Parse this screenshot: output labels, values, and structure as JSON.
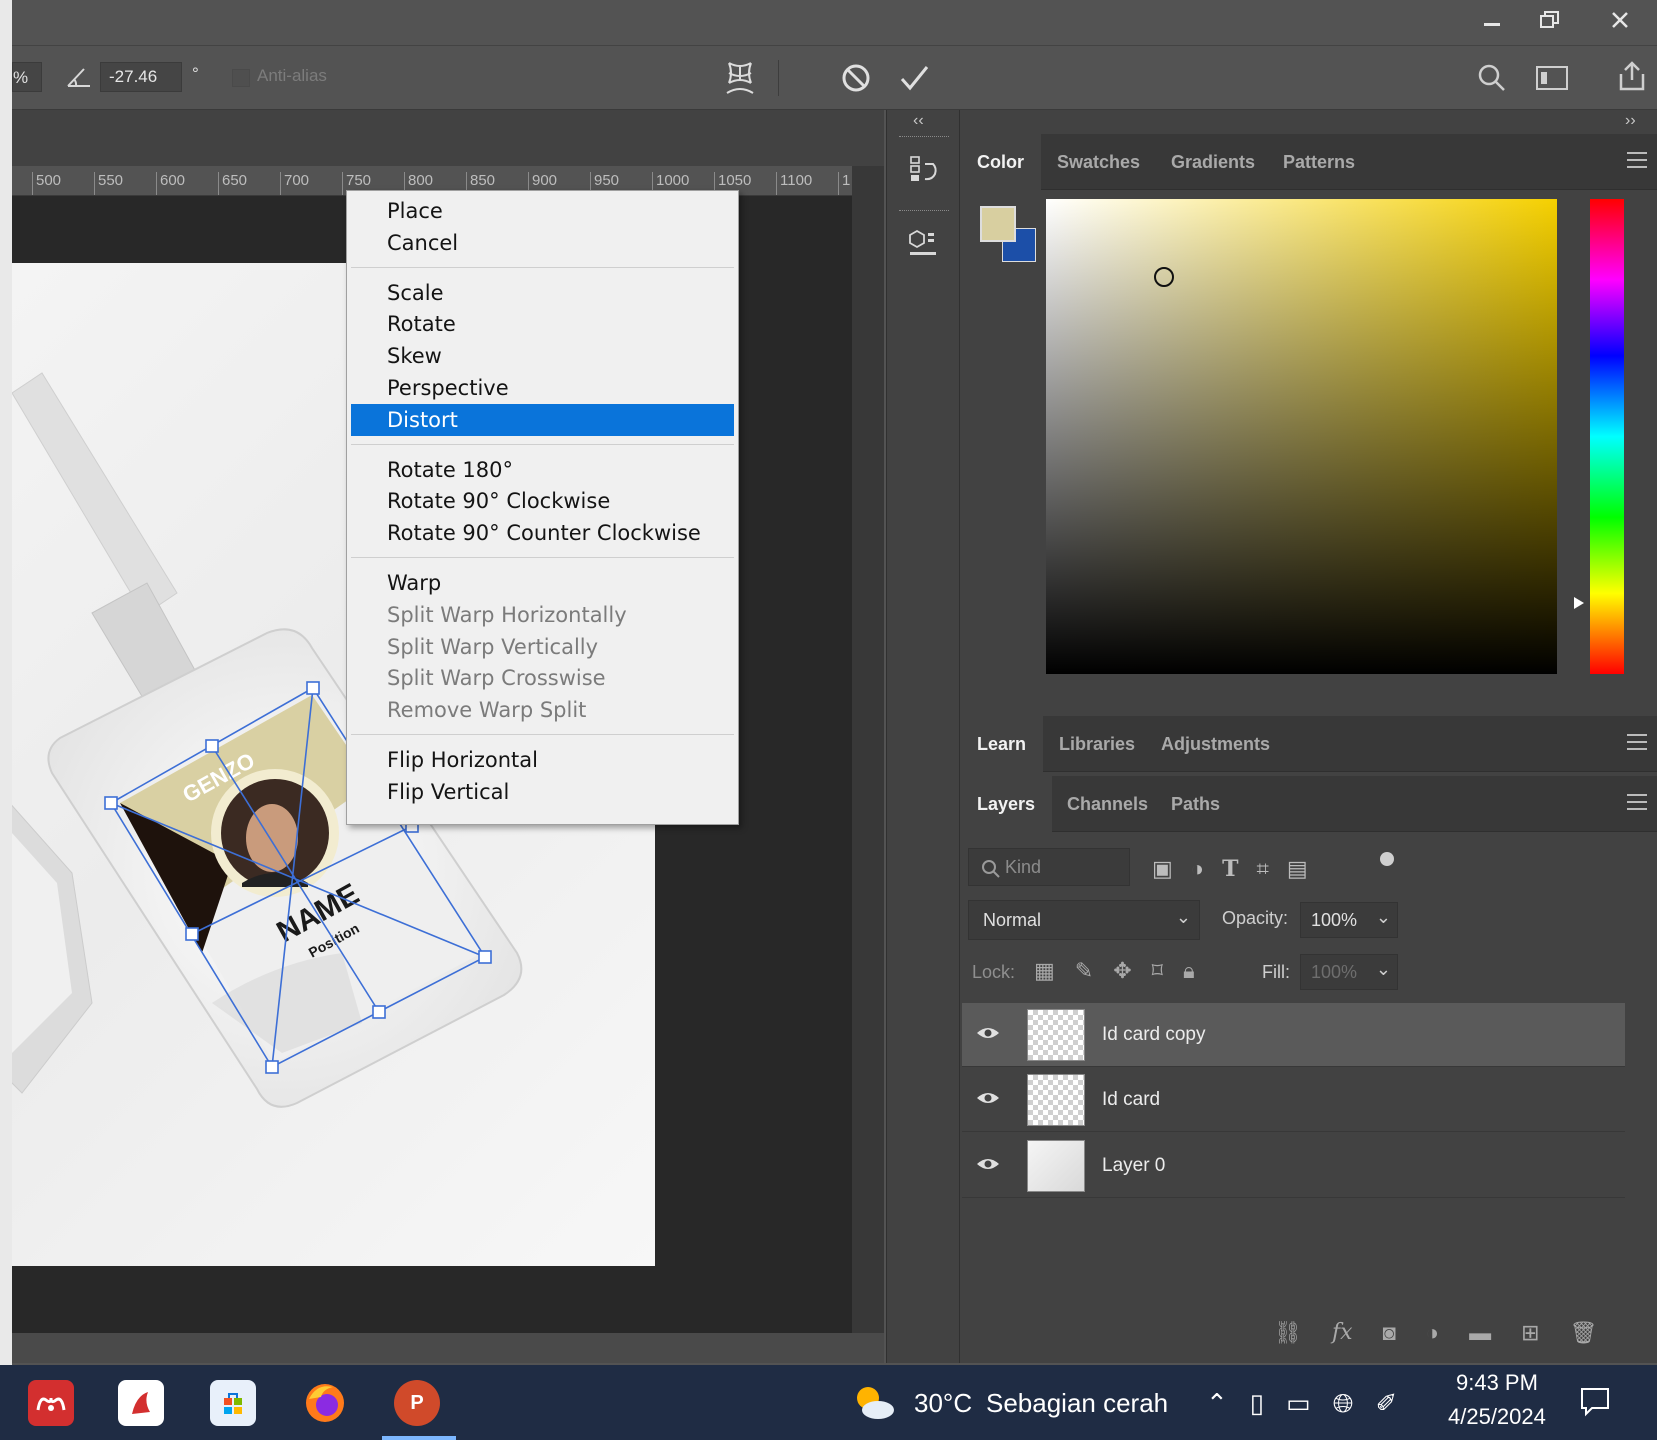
{
  "window": {
    "controls": {
      "minimize": "minimize-icon",
      "restore": "restore-icon",
      "close": "close-icon"
    }
  },
  "options_bar": {
    "percent_fragment": "%",
    "angle_value": "-27.46",
    "angle_unit": "°",
    "antialias_label": "Anti-alias"
  },
  "ruler": {
    "ticks": [
      "500",
      "550",
      "600",
      "650",
      "700",
      "750",
      "800",
      "850",
      "900",
      "950",
      "1000",
      "1050",
      "1100",
      "1"
    ]
  },
  "artwork": {
    "card_header": "GENZO",
    "card_name": "NAME",
    "card_position": "Position"
  },
  "context_menu": {
    "items": [
      {
        "label": "Place",
        "enabled": true
      },
      {
        "label": "Cancel",
        "enabled": true
      },
      {
        "label": "Scale",
        "enabled": true
      },
      {
        "label": "Rotate",
        "enabled": true
      },
      {
        "label": "Skew",
        "enabled": true
      },
      {
        "label": "Perspective",
        "enabled": true
      },
      {
        "label": "Distort",
        "enabled": true,
        "highlighted": true
      },
      {
        "label": "Rotate 180°",
        "enabled": true
      },
      {
        "label": "Rotate 90° Clockwise",
        "enabled": true
      },
      {
        "label": "Rotate 90° Counter Clockwise",
        "enabled": true
      },
      {
        "label": "Warp",
        "enabled": true
      },
      {
        "label": "Split Warp Horizontally",
        "enabled": false
      },
      {
        "label": "Split Warp Vertically",
        "enabled": false
      },
      {
        "label": "Split Warp Crosswise",
        "enabled": false
      },
      {
        "label": "Remove Warp Split",
        "enabled": false
      },
      {
        "label": "Flip Horizontal",
        "enabled": true
      },
      {
        "label": "Flip Vertical",
        "enabled": true
      }
    ]
  },
  "color_panel": {
    "tabs": [
      "Color",
      "Swatches",
      "Gradients",
      "Patterns"
    ],
    "active_tab": "Color",
    "foreground": "#d8cfa0",
    "background": "#1c4fa8",
    "hue": "#f5d000"
  },
  "learn_panel": {
    "tabs": [
      "Learn",
      "Libraries",
      "Adjustments"
    ],
    "active_tab": "Learn"
  },
  "layers_panel": {
    "tabs": [
      "Layers",
      "Channels",
      "Paths"
    ],
    "active_tab": "Layers",
    "filter_placeholder": "Kind",
    "blend_mode": "Normal",
    "opacity_label": "Opacity:",
    "opacity_value": "100%",
    "lock_label": "Lock:",
    "fill_label": "Fill:",
    "fill_value": "100%",
    "layers": [
      {
        "name": "Id card copy",
        "visible": true,
        "selected": true
      },
      {
        "name": "Id card",
        "visible": true,
        "selected": false
      },
      {
        "name": "Layer 0",
        "visible": true,
        "selected": false
      }
    ]
  },
  "taskbar": {
    "weather_temp": "30°C",
    "weather_text": "Sebagian cerah",
    "time": "9:43 PM",
    "date": "4/25/2024",
    "powerpoint_letter": "P"
  }
}
